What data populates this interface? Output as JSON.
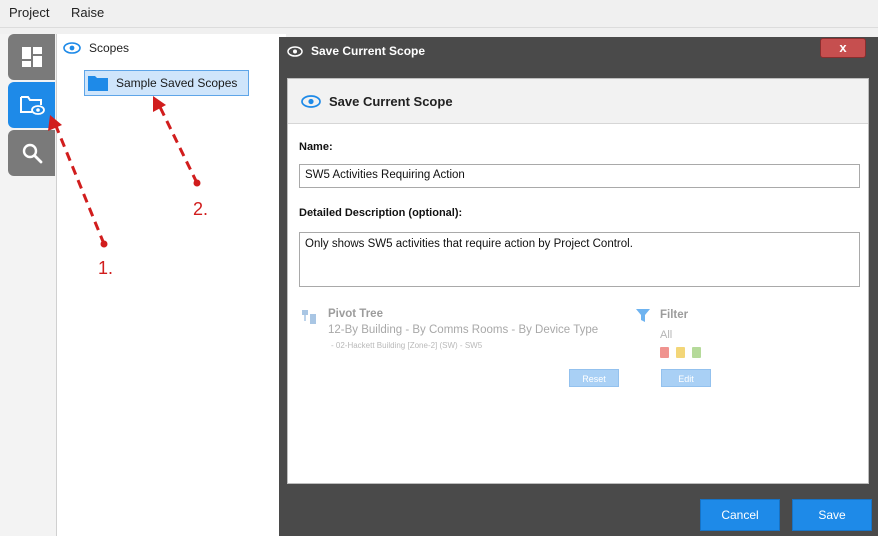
{
  "menu": {
    "project": "Project",
    "raise": "Raise"
  },
  "sidebar": {
    "items": [
      {
        "icon": "dashboard-icon"
      },
      {
        "icon": "folder-eye-icon",
        "active": true
      },
      {
        "icon": "search-icon"
      }
    ]
  },
  "scopes": {
    "header": "Scopes",
    "tree": [
      {
        "label": "Sample Saved Scopes"
      }
    ]
  },
  "annotations": {
    "one": "1.",
    "two": "2."
  },
  "dialog": {
    "window_title": "Save Current Scope",
    "close_label": "x",
    "heading": "Save Current Scope",
    "name_label": "Name:",
    "name_value": "SW5 Activities Requiring Action",
    "desc_label": "Detailed Description (optional):",
    "desc_value": "Only shows SW5 activities that require action by Project Control.",
    "pivot": {
      "title": "Pivot Tree",
      "path": "12-By Building - By Comms Rooms - By Device Type",
      "sub": "- 02-Hackett Building [Zone-2] (SW) - SW5",
      "reset_label": "Reset"
    },
    "filter": {
      "title": "Filter",
      "value": "All",
      "edit_label": "Edit"
    },
    "cancel_label": "Cancel",
    "save_label": "Save"
  },
  "colors": {
    "accent": "#1e8ae8",
    "annotation": "#d11d1d",
    "dialog_frame": "#4a4a4a"
  }
}
